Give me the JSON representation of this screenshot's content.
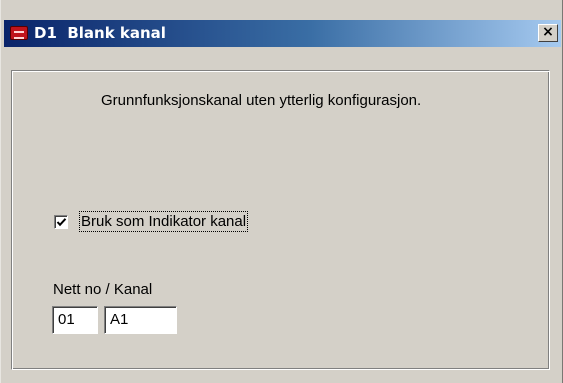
{
  "window": {
    "title": "D1  Blank kanal",
    "close_label": "×",
    "app_icon": "app-icon"
  },
  "content": {
    "description": "Grunnfunksjonskanal uten ytterlig konfigurasjon.",
    "indicator_checkbox": {
      "label": "Bruk som Indikator kanal",
      "checked": true
    },
    "net_channel": {
      "label": "Nett no / Kanal",
      "net_value": "01",
      "channel_value": "A1"
    }
  },
  "colors": {
    "titlebar_start": "#0a246a",
    "titlebar_end": "#a6caf0",
    "dialog_background": "#d4d0c8"
  }
}
